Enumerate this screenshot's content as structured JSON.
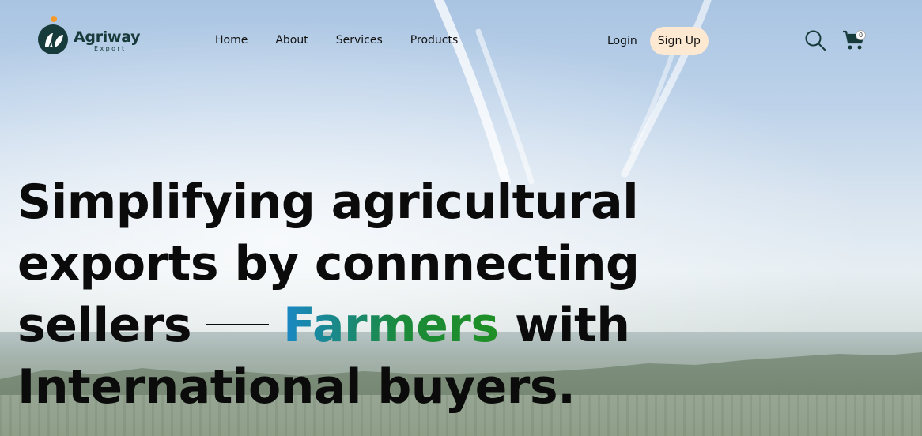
{
  "brand": {
    "name": "Agriway",
    "tagline": "Export",
    "colors": {
      "primary": "#173a3a",
      "accent": "#f59a2b",
      "signup_bg": "#fde9d1"
    }
  },
  "nav": {
    "items": [
      {
        "label": "Home"
      },
      {
        "label": "About"
      },
      {
        "label": "Services"
      },
      {
        "label": "Products"
      }
    ]
  },
  "auth": {
    "login_label": "Login",
    "signup_label": "Sign Up"
  },
  "actions": {
    "search_icon": "search-icon",
    "cart_icon": "cart-icon",
    "cart_count": "0"
  },
  "hero": {
    "line1": "Simplifying agricultural",
    "line2": "exports by connnecting",
    "line3_pre": "sellers",
    "line3_highlight": "Farmers",
    "line3_post": "with",
    "line4": "International buyers.",
    "highlight_gradient": [
      "#1a88c6",
      "#1f8f25"
    ]
  }
}
